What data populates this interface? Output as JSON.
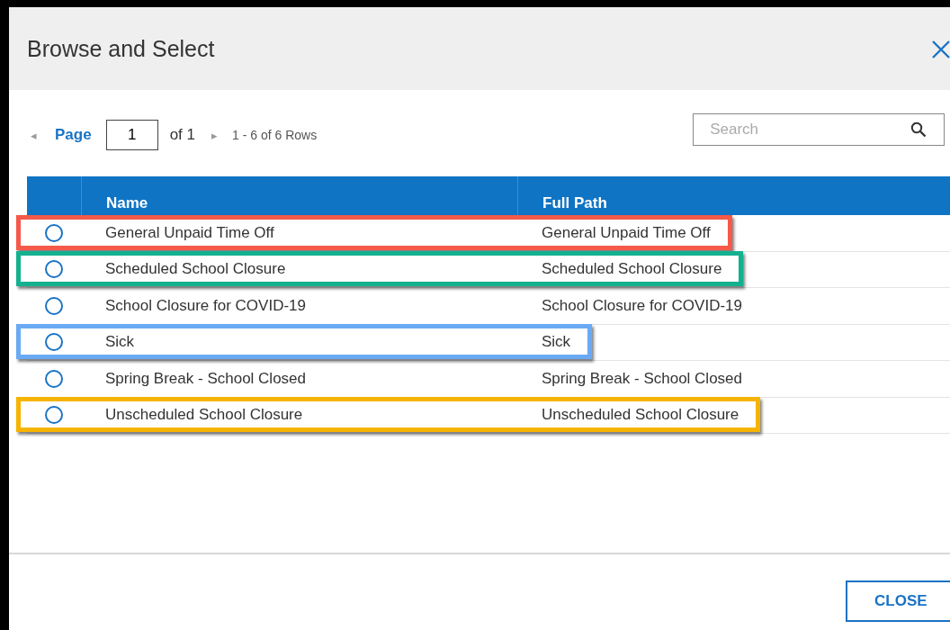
{
  "dialog": {
    "title": "Browse and Select"
  },
  "pager": {
    "prev": "◂",
    "label": "Page",
    "page": "1",
    "of": "of 1",
    "next": "▸",
    "summary": "1 - 6 of 6 Rows"
  },
  "search": {
    "placeholder": "Search"
  },
  "table": {
    "columns": [
      "Name",
      "Full Path"
    ],
    "rows": [
      {
        "name": "General Unpaid Time Off",
        "path": "General Unpaid Time Off",
        "selected": false,
        "color": "#f4594a"
      },
      {
        "name": "Scheduled School Closure",
        "path": "Scheduled School Closure",
        "selected": false,
        "color": "#14b18f"
      },
      {
        "name": "School Closure for COVID-19",
        "path": "School Closure for COVID-19",
        "selected": false
      },
      {
        "name": "Sick",
        "path": "Sick",
        "selected": false,
        "color": "#6aaaf4"
      },
      {
        "name": "Spring Break - School Closed",
        "path": "Spring Break - School Closed",
        "selected": false
      },
      {
        "name": "Unscheduled School Closure",
        "path": "Unscheduled School Closure",
        "selected": false,
        "color": "#f6b400"
      }
    ]
  },
  "buttons": [
    "CLOSE"
  ]
}
